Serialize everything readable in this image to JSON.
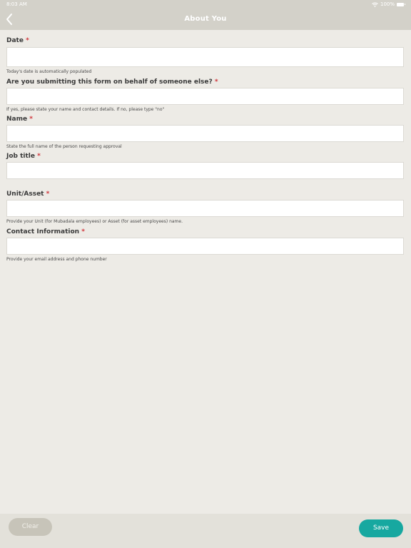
{
  "status_bar": {
    "time": "8:03 AM",
    "battery": "100%"
  },
  "header": {
    "title": "About You",
    "back_icon": "chevron-left-icon"
  },
  "colors": {
    "header_bg": "#d3d1c9",
    "page_bg": "#edebe6",
    "required": "#d0343a",
    "save_button": "#17a8a0",
    "clear_button": "#c7c4b9"
  },
  "form": {
    "fields": [
      {
        "label": "Date",
        "required_mark": "*",
        "value": "",
        "hint": "Today's date is automatically populated"
      },
      {
        "label": "Are you submitting this form on behalf of someone else?",
        "required_mark": "*",
        "value": "",
        "hint": "If yes, please state your name and contact details. If no, please type \"no\""
      },
      {
        "label": "Name",
        "required_mark": "*",
        "value": "",
        "hint": "State the full name of the person requesting approval"
      },
      {
        "label": "Job title",
        "required_mark": "*",
        "value": "",
        "hint": ""
      },
      {
        "label": "Unit/Asset",
        "required_mark": "*",
        "value": "",
        "hint": "Provide your Unit (for Mubadala employees) or Asset (for asset employees) name."
      },
      {
        "label": "Contact Information",
        "required_mark": "*",
        "value": "",
        "hint": "Provide your email address and phone number"
      }
    ]
  },
  "footer": {
    "clear_label": "Clear",
    "save_label": "Save"
  }
}
